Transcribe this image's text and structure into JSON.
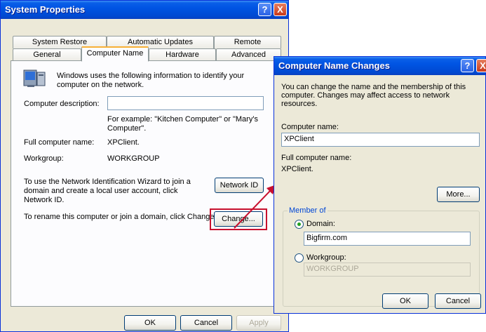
{
  "sysprops": {
    "title": "System Properties",
    "help_label": "?",
    "close_label": "X",
    "tabs_row1": [
      "System Restore",
      "Automatic Updates",
      "Remote"
    ],
    "tabs_row2": [
      "General",
      "Computer Name",
      "Hardware",
      "Advanced"
    ],
    "intro": "Windows uses the following information to identify your computer on the network.",
    "desc_label": "Computer description:",
    "desc_value": "",
    "desc_example": "For example: \"Kitchen Computer\" or \"Mary's Computer\".",
    "full_name_label": "Full computer name:",
    "full_name_value": "XPClient.",
    "workgroup_label": "Workgroup:",
    "workgroup_value": "WORKGROUP",
    "wizard_text": "To use the Network Identification Wizard to join a domain and create a local user account, click Network ID.",
    "network_id_button": "Network ID",
    "rename_text": "To rename this computer or join a domain, click Change.",
    "change_button": "Change...",
    "ok_button": "OK",
    "cancel_button": "Cancel",
    "apply_button": "Apply"
  },
  "cnc": {
    "title": "Computer Name Changes",
    "help_label": "?",
    "close_label": "X",
    "intro": "You can change the name and the membership of this computer. Changes may affect access to network resources.",
    "name_label": "Computer name:",
    "name_value": "XPClient",
    "full_label": "Full computer name:",
    "full_value": "XPClient.",
    "more_button": "More...",
    "member_of": "Member of",
    "domain_label": "Domain:",
    "domain_value": "Bigfirm.com",
    "workgroup_label": "Workgroup:",
    "workgroup_value": "WORKGROUP",
    "ok_button": "OK",
    "cancel_button": "Cancel"
  },
  "colors": {
    "highlight": "#c8102e",
    "title_blue": "#0054e3"
  }
}
